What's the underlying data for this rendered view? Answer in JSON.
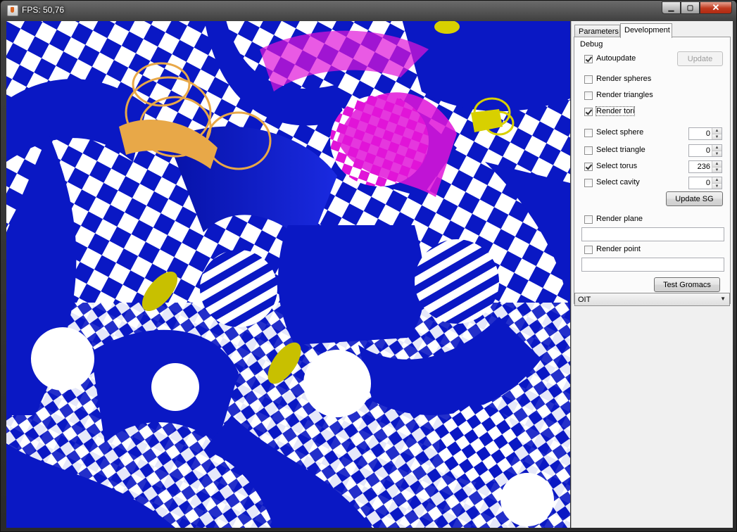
{
  "window": {
    "title": "FPS: 50,76",
    "controls": {
      "minimize": "▁",
      "maximize": "▢",
      "close": "✕"
    }
  },
  "tabs": [
    {
      "label": "Parameters",
      "active": false
    },
    {
      "label": "Development",
      "active": true
    }
  ],
  "debug": {
    "group_label": "Debug",
    "autoupdate": {
      "label": "Autoupdate",
      "checked": true
    },
    "update_button": "Update",
    "render_spheres": {
      "label": "Render spheres",
      "checked": false
    },
    "render_triangles": {
      "label": "Render triangles",
      "checked": false
    },
    "render_tori": {
      "label": "Render tori",
      "checked": true
    },
    "select_sphere": {
      "label": "Select sphere",
      "checked": false,
      "value": "0"
    },
    "select_triangle": {
      "label": "Select triangle",
      "checked": false,
      "value": "0"
    },
    "select_torus": {
      "label": "Select torus",
      "checked": true,
      "value": "236"
    },
    "select_cavity": {
      "label": "Select cavity",
      "checked": false,
      "value": "0"
    },
    "update_sg_button": "Update SG",
    "render_plane": {
      "label": "Render plane",
      "checked": false,
      "value": ""
    },
    "render_point": {
      "label": "Render point",
      "checked": false,
      "value": ""
    },
    "test_gromacs_button": "Test Gromacs"
  },
  "render_mode": {
    "selected": "OIT"
  },
  "icons": {
    "app": "java-cup-icon",
    "spin_up": "▲",
    "spin_down": "▼",
    "combo_arrow": "▼"
  },
  "colors": {
    "surface_blue": "#0a18c4",
    "magenta": "#e014d8",
    "orange": "#e8a848",
    "yellow": "#d8d000",
    "background": "#ffffff"
  }
}
